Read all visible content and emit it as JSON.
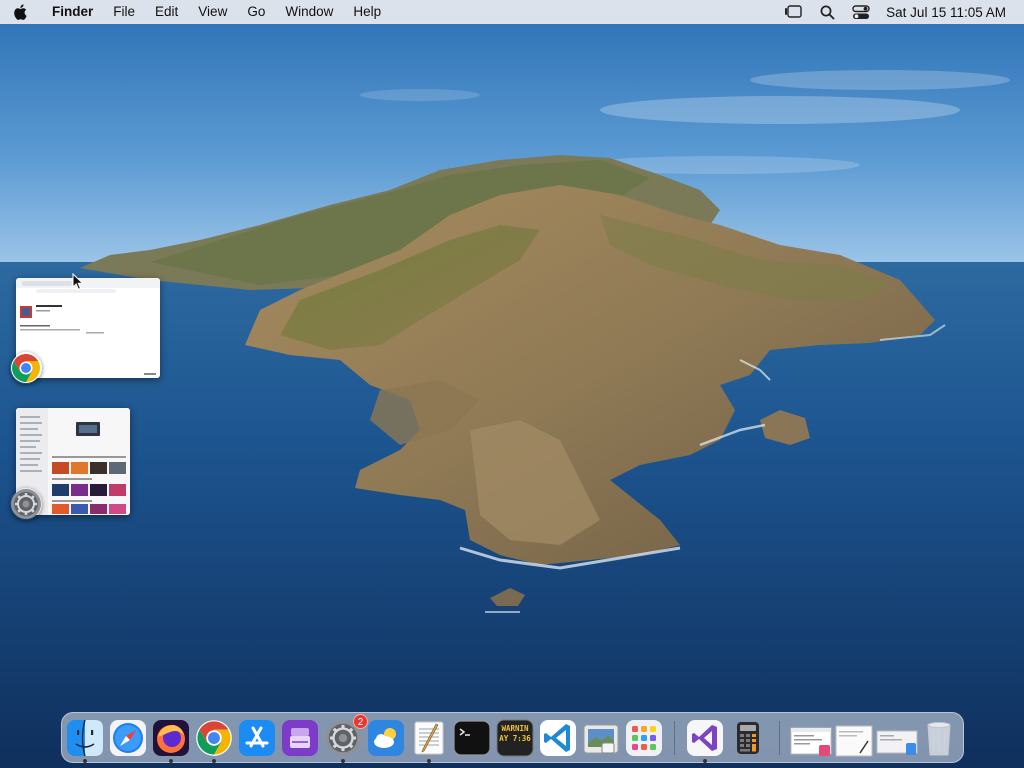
{
  "menubar": {
    "apple_icon": "apple-icon",
    "app_name": "Finder",
    "menus": [
      "File",
      "Edit",
      "View",
      "Go",
      "Window",
      "Help"
    ],
    "status_icons": [
      "stage-manager-icon",
      "spotlight-icon",
      "control-center-icon"
    ],
    "datetime": "Sat Jul 15  11:05 AM"
  },
  "stage_manager": [
    {
      "app": "Google Chrome",
      "icon": "chrome-icon"
    },
    {
      "app": "System Settings",
      "icon": "settings-icon"
    }
  ],
  "dock": {
    "items": [
      {
        "name": "Finder",
        "icon": "finder-icon",
        "running": true
      },
      {
        "name": "Safari",
        "icon": "safari-icon",
        "running": false
      },
      {
        "name": "Firefox",
        "icon": "firefox-icon",
        "running": true
      },
      {
        "name": "Google Chrome",
        "icon": "chrome-icon",
        "running": true
      },
      {
        "name": "App Store",
        "icon": "app-store-icon",
        "running": false
      },
      {
        "name": "Apple Configurator",
        "icon": "configurator-icon",
        "running": false
      },
      {
        "name": "System Settings",
        "icon": "settings-icon",
        "running": true,
        "badge": "2"
      },
      {
        "name": "Weather",
        "icon": "weather-icon",
        "running": false
      },
      {
        "name": "TextEdit",
        "icon": "textedit-icon",
        "running": true
      },
      {
        "name": "Terminal",
        "icon": "terminal-icon",
        "running": false
      },
      {
        "name": "Console",
        "icon": "console-icon",
        "running": false,
        "label": "WARNIN\nAY 7:36"
      },
      {
        "name": "Visual Studio Code",
        "icon": "vscode-icon",
        "running": false
      },
      {
        "name": "Preview",
        "icon": "preview-icon",
        "running": false
      },
      {
        "name": "Launchpad",
        "icon": "launchpad-icon",
        "running": false
      },
      {
        "name": "Visual Studio",
        "icon": "visual-studio-icon",
        "running": true
      },
      {
        "name": "Calculator",
        "icon": "calculator-icon",
        "running": false
      },
      {
        "name": "Recent Document 1",
        "icon": "document-thumb-icon",
        "running": false
      },
      {
        "name": "Recent Document 2",
        "icon": "document-thumb-icon",
        "running": false
      },
      {
        "name": "Recent Document 3",
        "icon": "document-thumb-icon",
        "running": false
      },
      {
        "name": "Trash",
        "icon": "trash-icon",
        "running": false
      }
    ]
  }
}
